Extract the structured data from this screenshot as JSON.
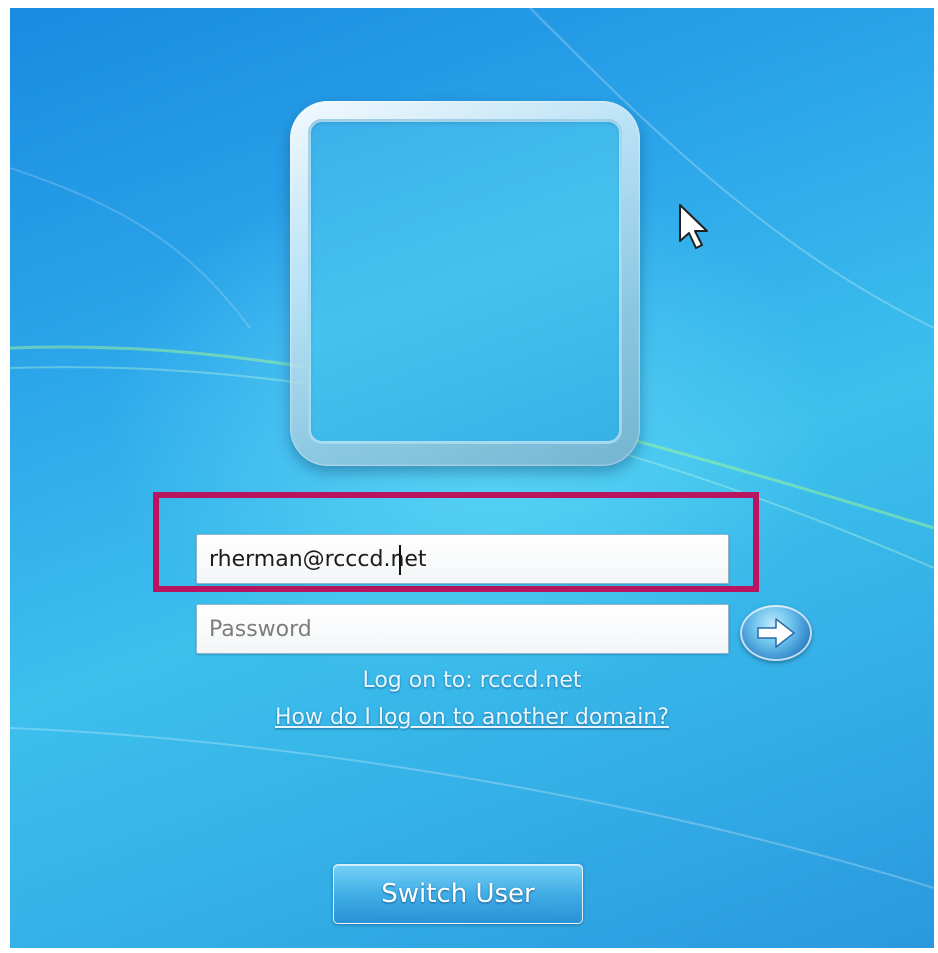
{
  "login": {
    "username_value": "rherman@rcccd.net",
    "password_placeholder": "Password",
    "logon_to": "Log on to: rcccd.net",
    "other_domain_link": "How do I log on to another domain?",
    "switch_user_label": "Switch User"
  },
  "icons": {
    "user_tile": "user-tile-icon",
    "submit_arrow": "arrow-right-icon",
    "mouse_cursor": "mouse-pointer-icon"
  },
  "colors": {
    "background_blue": "#2ca6ea",
    "highlight_border": "#b8145f",
    "text_light": "#e6f6ff"
  }
}
